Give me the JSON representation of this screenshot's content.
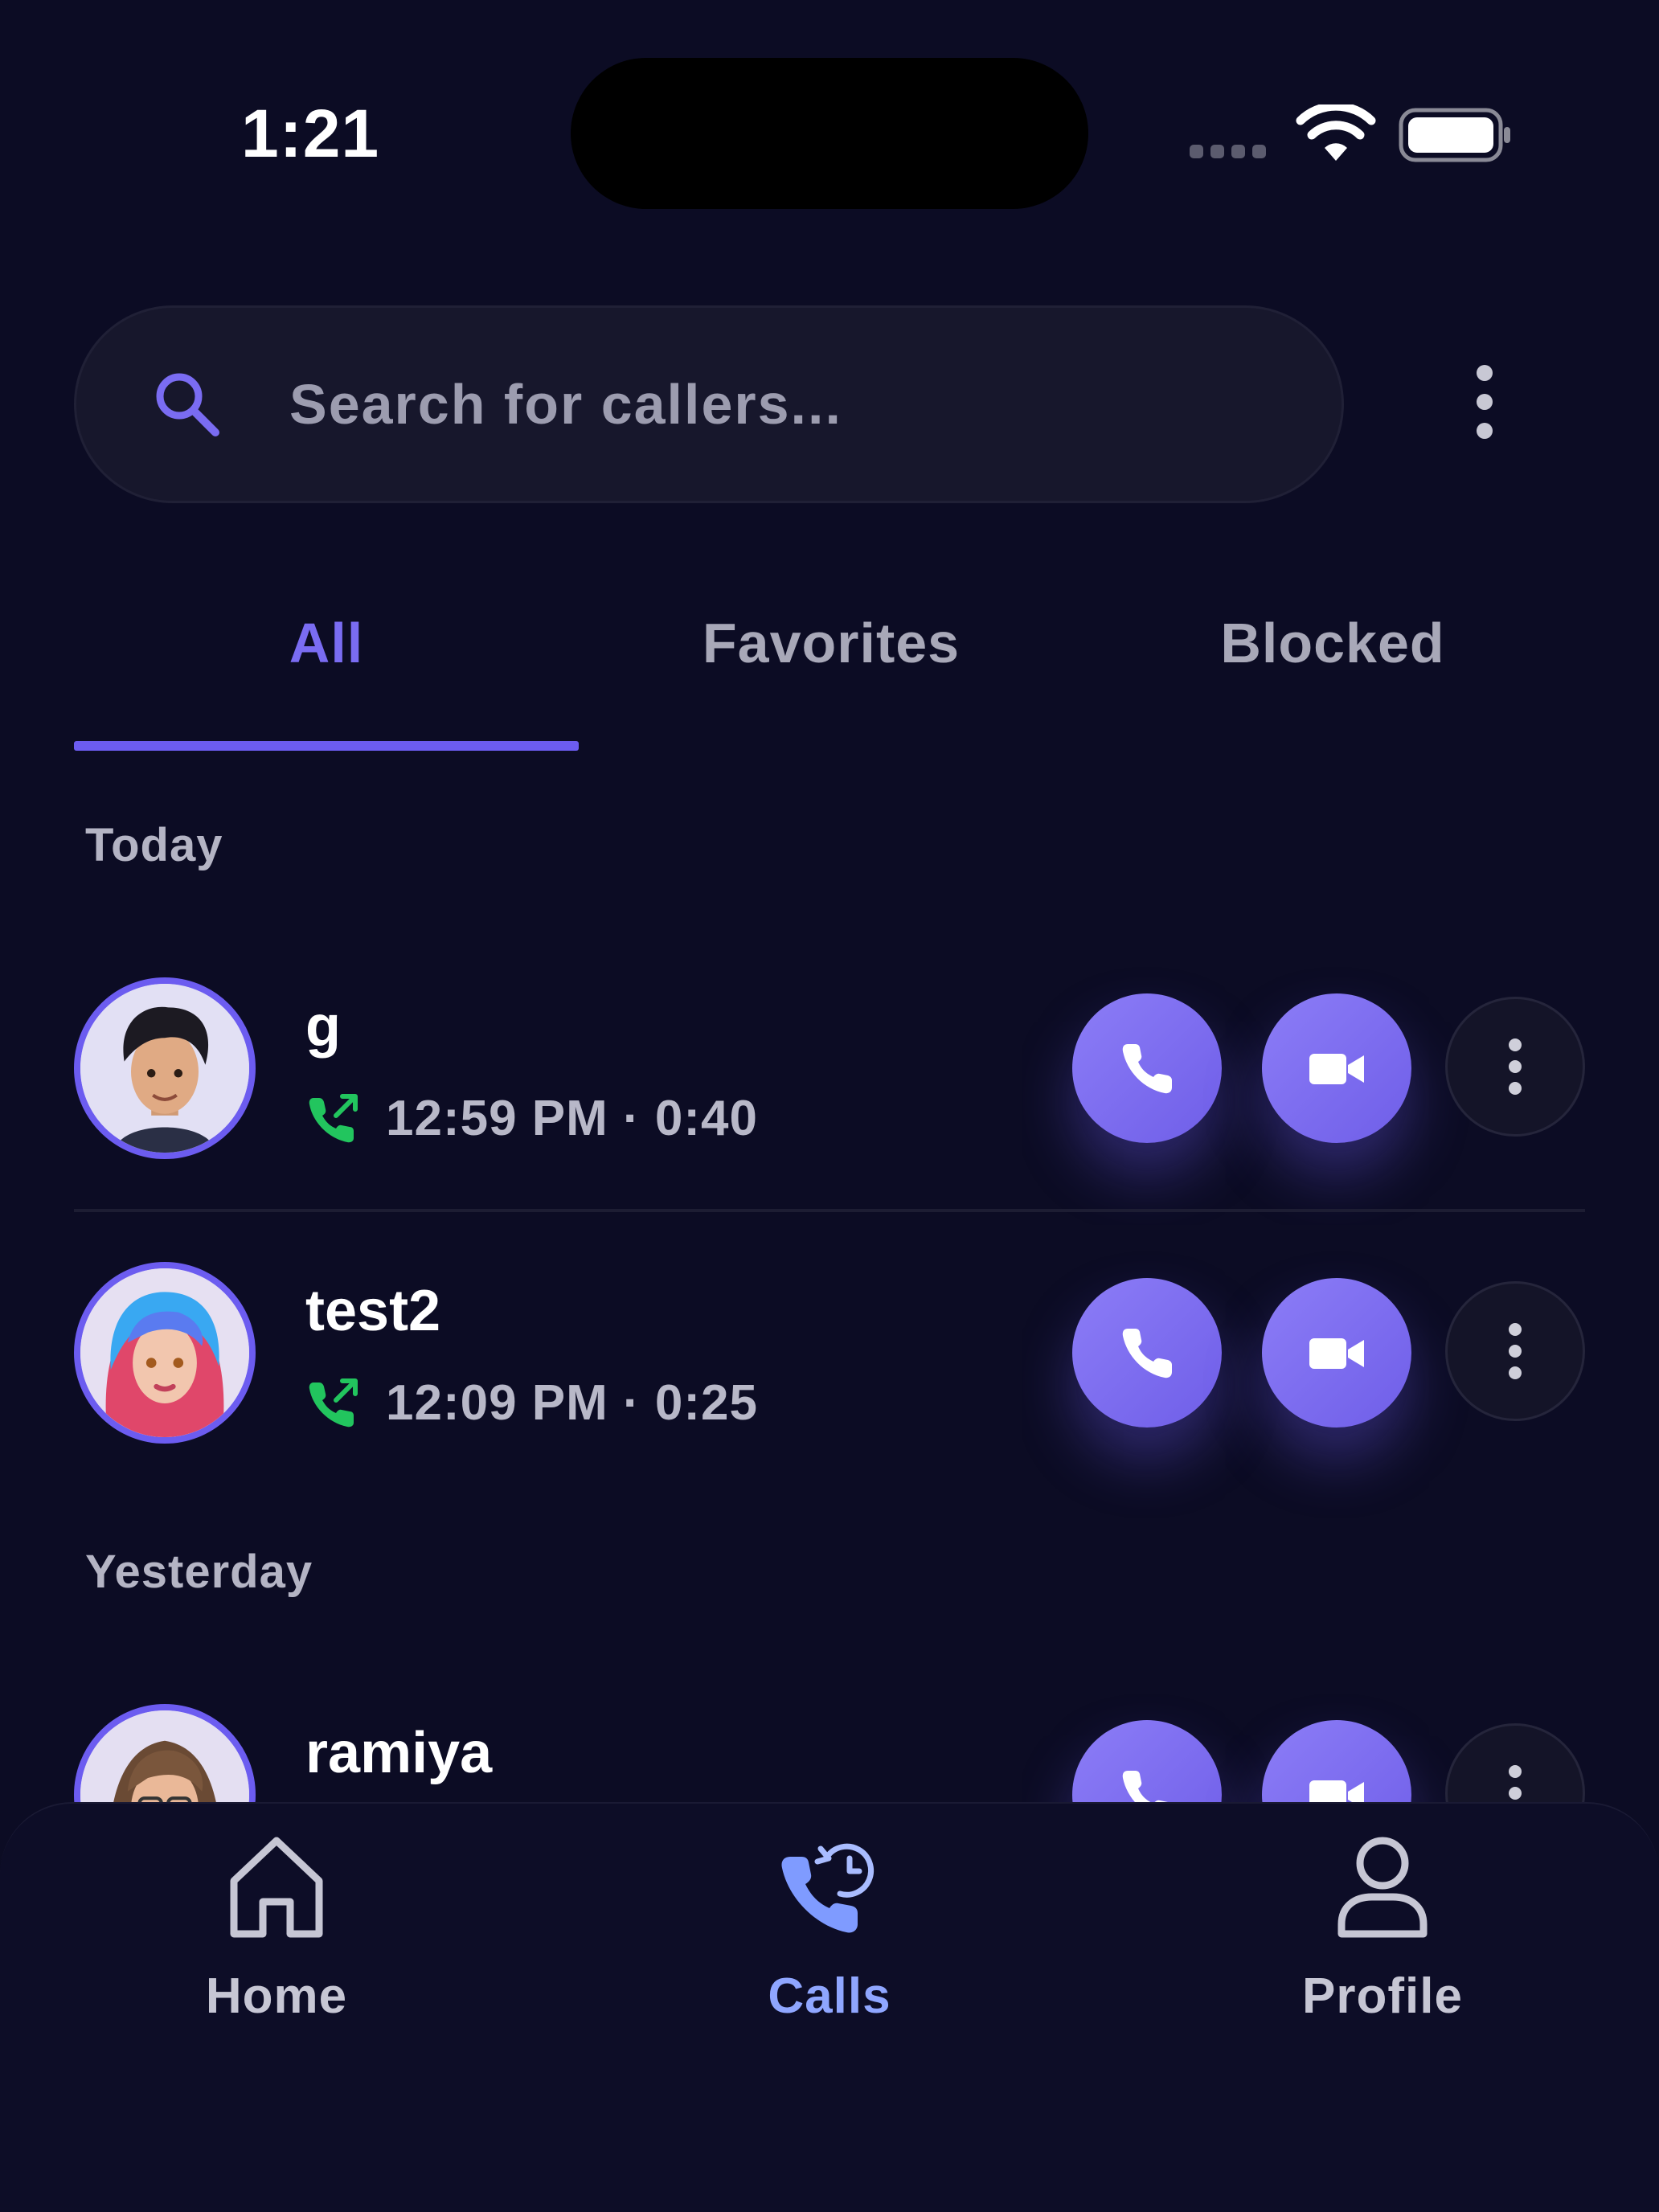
{
  "status_bar": {
    "time": "1:21"
  },
  "search": {
    "placeholder": "Search for callers..."
  },
  "tabs": [
    {
      "label": "All",
      "active": true
    },
    {
      "label": "Favorites",
      "active": false
    },
    {
      "label": "Blocked",
      "active": false
    }
  ],
  "sections": [
    {
      "label": "Today",
      "calls": [
        {
          "name": "g",
          "time": "12:59 PM",
          "duration": "0:40",
          "meta": "12:59 PM · 0:40",
          "avatar": "cartoon-man-avatar"
        },
        {
          "name": "test2",
          "time": "12:09 PM",
          "duration": "0:25",
          "meta": "12:09 PM · 0:25",
          "avatar": "cartoon-woman-colorful-hair-avatar"
        }
      ]
    },
    {
      "label": "Yesterday",
      "calls": [
        {
          "name": "ramiya",
          "avatar": "cartoon-woman-glasses-avatar"
        }
      ]
    }
  ],
  "bottom_nav": [
    {
      "label": "Home",
      "icon": "home-icon",
      "active": false
    },
    {
      "label": "Calls",
      "icon": "call-history-icon",
      "active": true
    },
    {
      "label": "Profile",
      "icon": "profile-icon",
      "active": false
    }
  ],
  "colors": {
    "background": "#0c0c24",
    "accent": "#6c5cf0",
    "active_nav": "#8fa6ff",
    "call_connected_green": "#22c55e"
  }
}
